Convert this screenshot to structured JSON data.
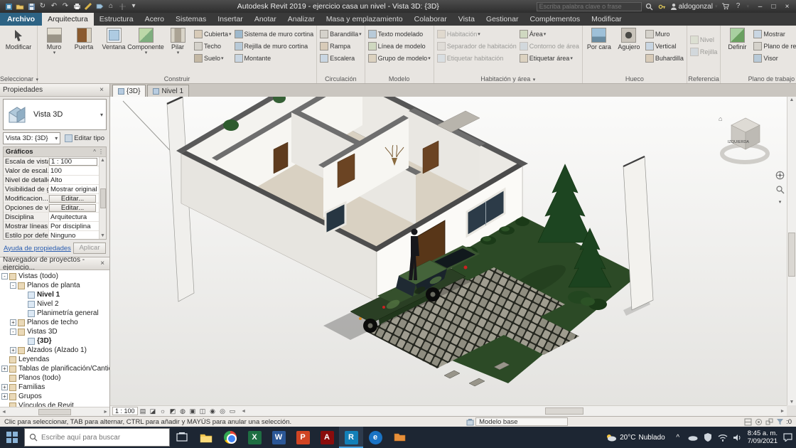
{
  "icons": {
    "close": "×",
    "minimize": "–",
    "maximize": "□",
    "dropdown": "▾",
    "scroll_up": "▲",
    "scroll_down": "▼",
    "scroll_left": "◄",
    "scroll_right": "►",
    "collapse": "^",
    "overflow": "⋮",
    "help": "?",
    "home": "⌂",
    "undo": "↶",
    "redo": "↷",
    "sync": "↻"
  },
  "titlebar": {
    "title": "Autodesk Revit 2019 - ejercicio casa un nivel - Vista 3D: {3D}",
    "search_placeholder": "Escriba palabra clave o frase",
    "username": "aldogonzal"
  },
  "ribbon": {
    "tabs": [
      "Archivo",
      "Arquitectura",
      "Estructura",
      "Acero",
      "Sistemas",
      "Insertar",
      "Anotar",
      "Analizar",
      "Masa y emplazamiento",
      "Colaborar",
      "Vista",
      "Gestionar",
      "Complementos",
      "Modificar"
    ],
    "seleccionar": {
      "modificar": "Modificar",
      "label": "Seleccionar"
    },
    "construir": {
      "label": "Construir",
      "big": [
        "Muro",
        "Puerta",
        "Ventana",
        "Componente",
        "Pilar"
      ],
      "col1": [
        "Cubierta",
        "Techo",
        "Suelo"
      ],
      "col2": [
        "Sistema de muro cortina",
        "Rejilla de muro cortina",
        "Montante"
      ]
    },
    "circulacion": {
      "label": "Circulación",
      "items": [
        "Barandilla",
        "Rampa",
        "Escalera"
      ]
    },
    "modelo": {
      "label": "Modelo",
      "items": [
        "Texto modelado",
        "Línea de modelo",
        "Grupo de modelo"
      ]
    },
    "habitacion": {
      "label": "Habitación y área",
      "col1": [
        "Habitación",
        "Separador de habitación",
        "Etiquetar habitación"
      ],
      "col2": [
        "Área",
        "Contorno de área",
        "Etiquetar área"
      ]
    },
    "hueco": {
      "label": "Hueco",
      "big": [
        "Por cara",
        "Agujero"
      ],
      "col": [
        "Muro",
        "Vertical",
        "Buhardilla"
      ]
    },
    "referencia": {
      "label": "Referencia",
      "items": [
        "Nivel",
        "Rejilla"
      ]
    },
    "plano": {
      "label": "Plano de trabajo",
      "definir": "Definir",
      "col": [
        "Mostrar",
        "Plano de referencia",
        "Visor"
      ]
    }
  },
  "properties": {
    "title": "Propiedades",
    "type_name": "Vista 3D",
    "instance_name": "Vista 3D: {3D}",
    "edit_type": "Editar tipo",
    "group": "Gráficos",
    "rows": [
      {
        "label": "Escala de vista",
        "value": "1 : 100"
      },
      {
        "label": "Valor de escal...",
        "value": "100"
      },
      {
        "label": "Nivel de detalle",
        "value": "Alto"
      },
      {
        "label": "Visibilidad de g...",
        "value": "Mostrar original"
      },
      {
        "label": "Modificacion...",
        "value": "Editar..."
      },
      {
        "label": "Opciones de v...",
        "value": "Editar..."
      },
      {
        "label": "Disciplina",
        "value": "Arquitectura"
      },
      {
        "label": "Mostrar líneas...",
        "value": "Por disciplina"
      },
      {
        "label": "Estilo por defe...",
        "value": "Ninguno"
      }
    ],
    "help_link": "Ayuda de propiedades",
    "apply": "Aplicar"
  },
  "browser": {
    "title": "Navegador de proyectos - ejercicio...",
    "items": [
      {
        "label": "Vistas (todo)",
        "expander": "-"
      },
      {
        "label": "Planos de planta",
        "expander": "-"
      },
      {
        "label": "Nivel 1"
      },
      {
        "label": "Nivel 2"
      },
      {
        "label": "Planimetría general"
      },
      {
        "label": "Planos de techo",
        "expander": "+"
      },
      {
        "label": "Vistas 3D",
        "expander": "-"
      },
      {
        "label": "{3D}"
      },
      {
        "label": "Alzados (Alzado 1)",
        "expander": "+"
      },
      {
        "label": "Leyendas"
      },
      {
        "label": "Tablas de planificación/Cantidades",
        "expander": "+"
      },
      {
        "label": "Planos (todo)"
      },
      {
        "label": "Familias",
        "expander": "+"
      },
      {
        "label": "Grupos",
        "expander": "+"
      },
      {
        "label": "Vínculos de Revit"
      }
    ]
  },
  "view": {
    "tabs": [
      "{3D}",
      "Nivel 1"
    ],
    "viewcube": "IZQUIERDA",
    "scale": "1 : 100"
  },
  "statusbar": {
    "hint": "Clic para seleccionar, TAB para alternar, CTRL para añadir y MAYÚS para anular una selección.",
    "design_option": "Modelo base",
    "filter_count": ":0"
  },
  "taskbar": {
    "search_placeholder": "Escribe aquí para buscar",
    "weather_temp": "20°C",
    "weather_label": "Nublado",
    "time": "8:45 a. m.",
    "date": "7/09/2021"
  },
  "app_glyphs": {
    "excel": "X",
    "word": "W",
    "powerpoint": "P",
    "acrobat": "A",
    "revit": "R",
    "edge": "e"
  }
}
